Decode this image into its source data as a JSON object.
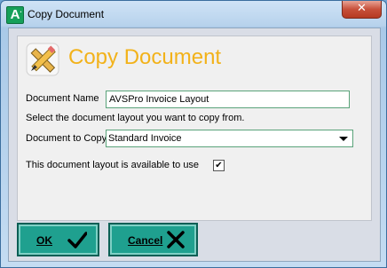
{
  "window": {
    "title": "Copy Document",
    "app_icon_letter": "A",
    "close_label": "✕"
  },
  "dialog": {
    "heading": "Copy Document",
    "document_name_label": "Document Name",
    "document_name_value": "AVSPro Invoice Layout",
    "instruction": "Select the document layout you want to copy from.",
    "document_to_copy_label": "Document to Copy",
    "document_to_copy_value": "Standard Invoice",
    "available_label": "This document layout is available to use",
    "available_checked": true,
    "check_mark": "✔"
  },
  "buttons": {
    "ok_label": "OK",
    "cancel_label": "Cancel"
  },
  "colors": {
    "heading": "#f2b21a",
    "button_bg": "#1fa08f",
    "field_border": "#5aa37a"
  }
}
